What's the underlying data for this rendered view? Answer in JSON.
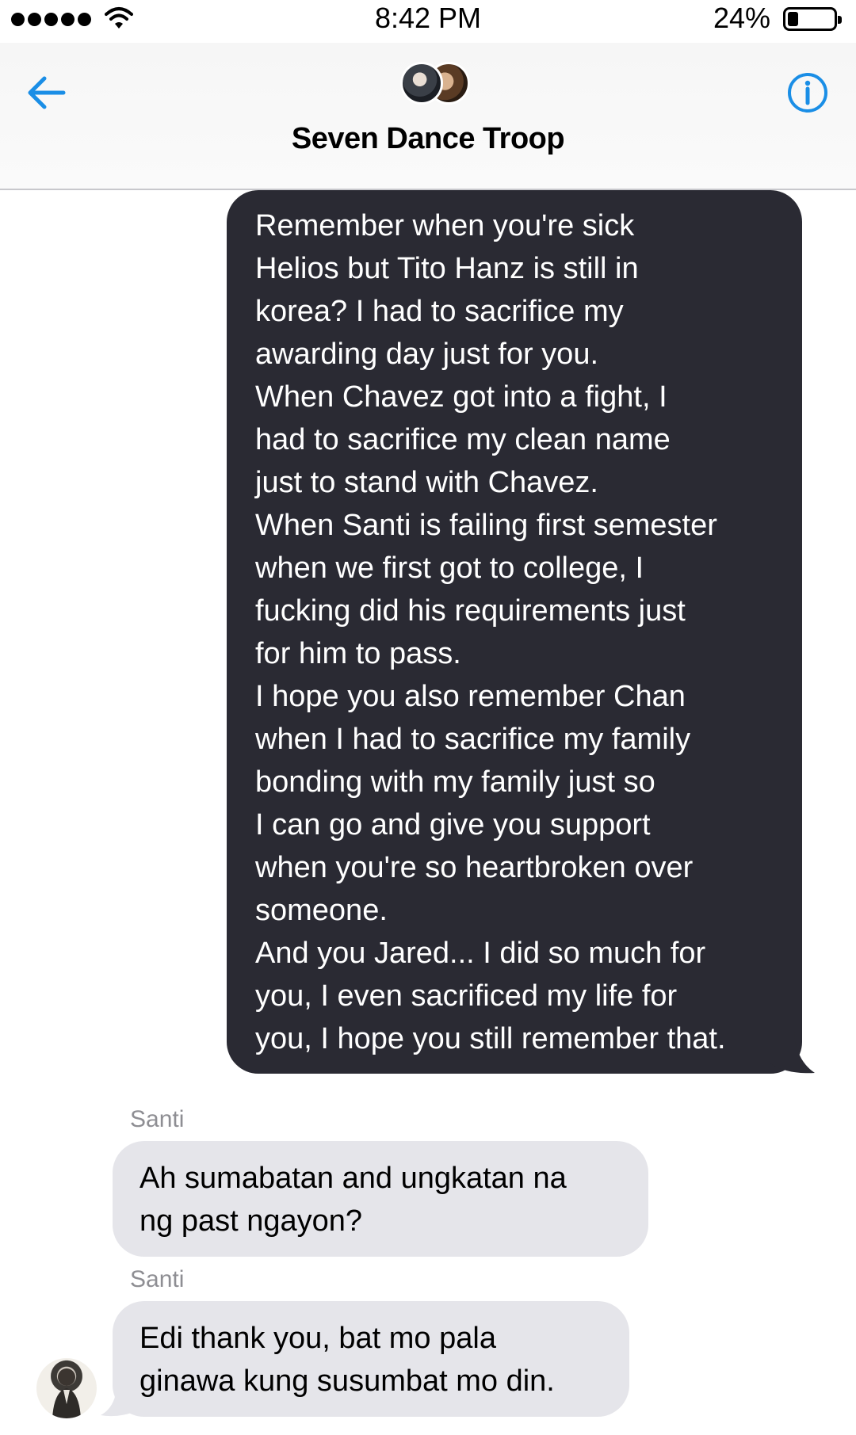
{
  "status_bar": {
    "time": "8:42 PM",
    "battery_percent": "24%",
    "battery_level": 0.24
  },
  "header": {
    "title": "Seven Dance Troop"
  },
  "messages": {
    "outgoing": {
      "lines": [
        "Remember when you're sick",
        "Helios but Tito Hanz is still in",
        "korea? I had to sacrifice my",
        "awarding day just for you.",
        "When Chavez got into a fight, I",
        "had to sacrifice my clean name",
        "just to stand with Chavez.",
        "When Santi is failing first semester",
        "when we first got to college, I",
        "fucking did his requirements just",
        "for him to pass.",
        "I hope you also remember Chan",
        "when I had to sacrifice my family",
        "bonding with my family just so",
        "I can go and give you support",
        "when you're so heartbroken over",
        "someone.",
        "And you Jared... I did so much for",
        "you, I even sacrificed my life for",
        "you, I hope you still remember that."
      ]
    },
    "incoming_1": {
      "sender": "Santi",
      "lines": [
        "Ah sumabatan and ungkatan na",
        "ng past ngayon?"
      ]
    },
    "incoming_2": {
      "sender": "Santi",
      "lines": [
        "Edi thank you, bat mo pala",
        "ginawa kung susumbat mo din."
      ]
    }
  },
  "colors": {
    "accent": "#1a8ee6",
    "outgoing_bubble": "#2a2a33",
    "incoming_bubble": "#e5e5ea",
    "sender_label": "#8e8e93"
  },
  "icons": {
    "back": "arrow-left-icon",
    "info": "info-circle-icon",
    "wifi": "wifi-icon",
    "battery": "battery-icon"
  }
}
